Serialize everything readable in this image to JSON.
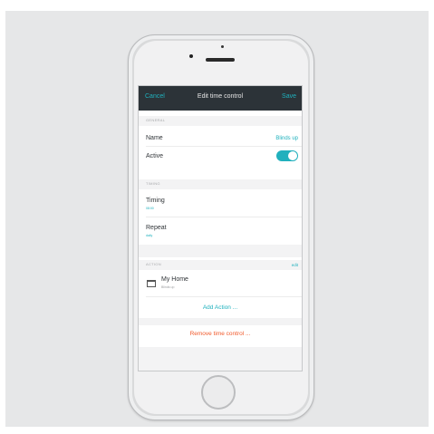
{
  "navbar": {
    "cancel_label": "Cancel",
    "title": "Edit time control",
    "save_label": "Save"
  },
  "sections": {
    "general_header": "GENERAL",
    "timing_header": "TIMING",
    "action_header": "ACTION"
  },
  "general": {
    "name_label": "Name",
    "name_value": "Blinds up",
    "active_label": "Active",
    "active_on": true
  },
  "timing": {
    "timing_label": "Timing",
    "timing_value": "08:00",
    "repeat_label": "Repeat",
    "repeat_value": "daily"
  },
  "action": {
    "edit_label": "edit",
    "device_name": "My Home",
    "device_sub": "Blinds up",
    "device_icon": "window-icon",
    "add_action_label": "Add Action ...",
    "remove_label": "Remove time control ..."
  },
  "colors": {
    "accent": "#1fb1bd",
    "destructive": "#f15a2b",
    "navbar": "#2c3338"
  }
}
